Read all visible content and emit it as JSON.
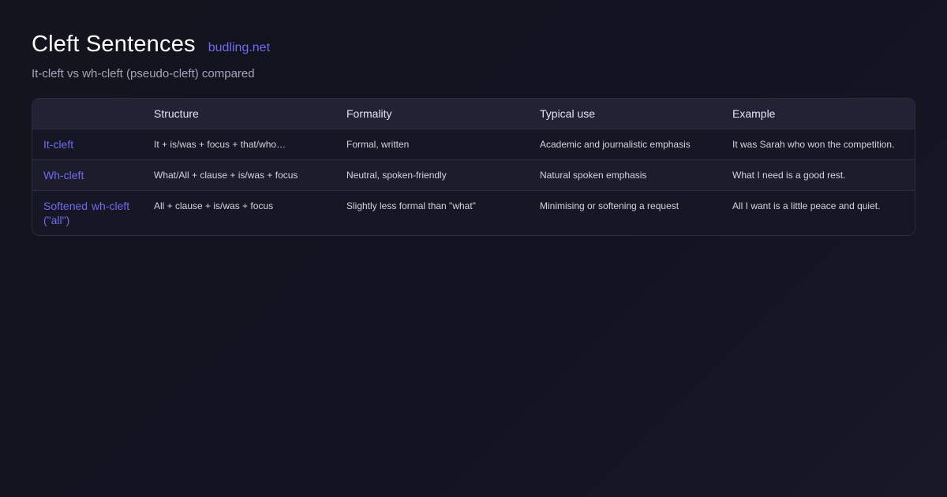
{
  "header": {
    "title": "Cleft Sentences",
    "site": "budling.net",
    "subtitle": "It-cleft vs wh-cleft (pseudo-cleft) compared"
  },
  "table": {
    "columns": [
      "",
      "Structure",
      "Formality",
      "Typical use",
      "Example"
    ],
    "rows": [
      {
        "label": "It-cleft",
        "structure": "It + is/was + focus + that/who…",
        "formality": "Formal, written",
        "typical_use": "Academic and journalistic emphasis",
        "example": "It was Sarah who won the competition."
      },
      {
        "label": "Wh-cleft",
        "structure": "What/All + clause + is/was + focus",
        "formality": "Neutral, spoken-friendly",
        "typical_use": "Natural spoken emphasis",
        "example": "What I need is a good rest."
      },
      {
        "label": "Softened wh-cleft (\"all\")",
        "structure": "All + clause + is/was + focus",
        "formality": "Slightly less formal than \"what\"",
        "typical_use": "Minimising or softening a request",
        "example": "All I want is a little peace and quiet."
      }
    ]
  },
  "colors": {
    "accent": "#6f6cf0",
    "background": "#14141f",
    "header_row": "#222235",
    "border": "#2c2c40"
  }
}
